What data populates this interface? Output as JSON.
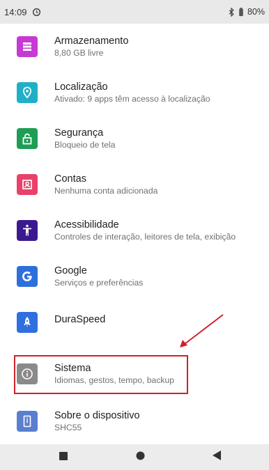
{
  "status_bar": {
    "time": "14:09",
    "battery": "80%",
    "icons": [
      "alarm-icon",
      "bluetooth-icon",
      "battery-icon"
    ]
  },
  "settings": {
    "items": [
      {
        "title": "Armazenamento",
        "subtitle": "8,80 GB livre",
        "icon": "storage-icon",
        "color": "#c739d3"
      },
      {
        "title": "Localização",
        "subtitle": "Ativado: 9 apps têm acesso à localização",
        "icon": "location-icon",
        "color": "#1fb0c8"
      },
      {
        "title": "Segurança",
        "subtitle": "Bloqueio de tela",
        "icon": "lock-icon",
        "color": "#1d9d55"
      },
      {
        "title": "Contas",
        "subtitle": "Nenhuma conta adicionada",
        "icon": "account-icon",
        "color": "#e8426b"
      },
      {
        "title": "Acessibilidade",
        "subtitle": "Controles de interação, leitores de tela, exibição",
        "icon": "accessibility-icon",
        "color": "#3b1a8f"
      },
      {
        "title": "Google",
        "subtitle": "Serviços e preferências",
        "icon": "google-icon",
        "color": "#2d6fdb"
      },
      {
        "title": "DuraSpeed",
        "subtitle": "",
        "icon": "rocket-icon",
        "color": "#2f6fe0"
      },
      {
        "title": "Sistema",
        "subtitle": "Idiomas, gestos, tempo, backup",
        "icon": "info-icon",
        "color": "#8a8a8a"
      },
      {
        "title": "Sobre o dispositivo",
        "subtitle": "SHC55",
        "icon": "phone-icon",
        "color": "#5a7fd0"
      }
    ]
  },
  "annotation": {
    "color": "#d0202a"
  },
  "nav_bar": {
    "icons": [
      "recents-icon",
      "home-icon",
      "back-icon"
    ]
  }
}
